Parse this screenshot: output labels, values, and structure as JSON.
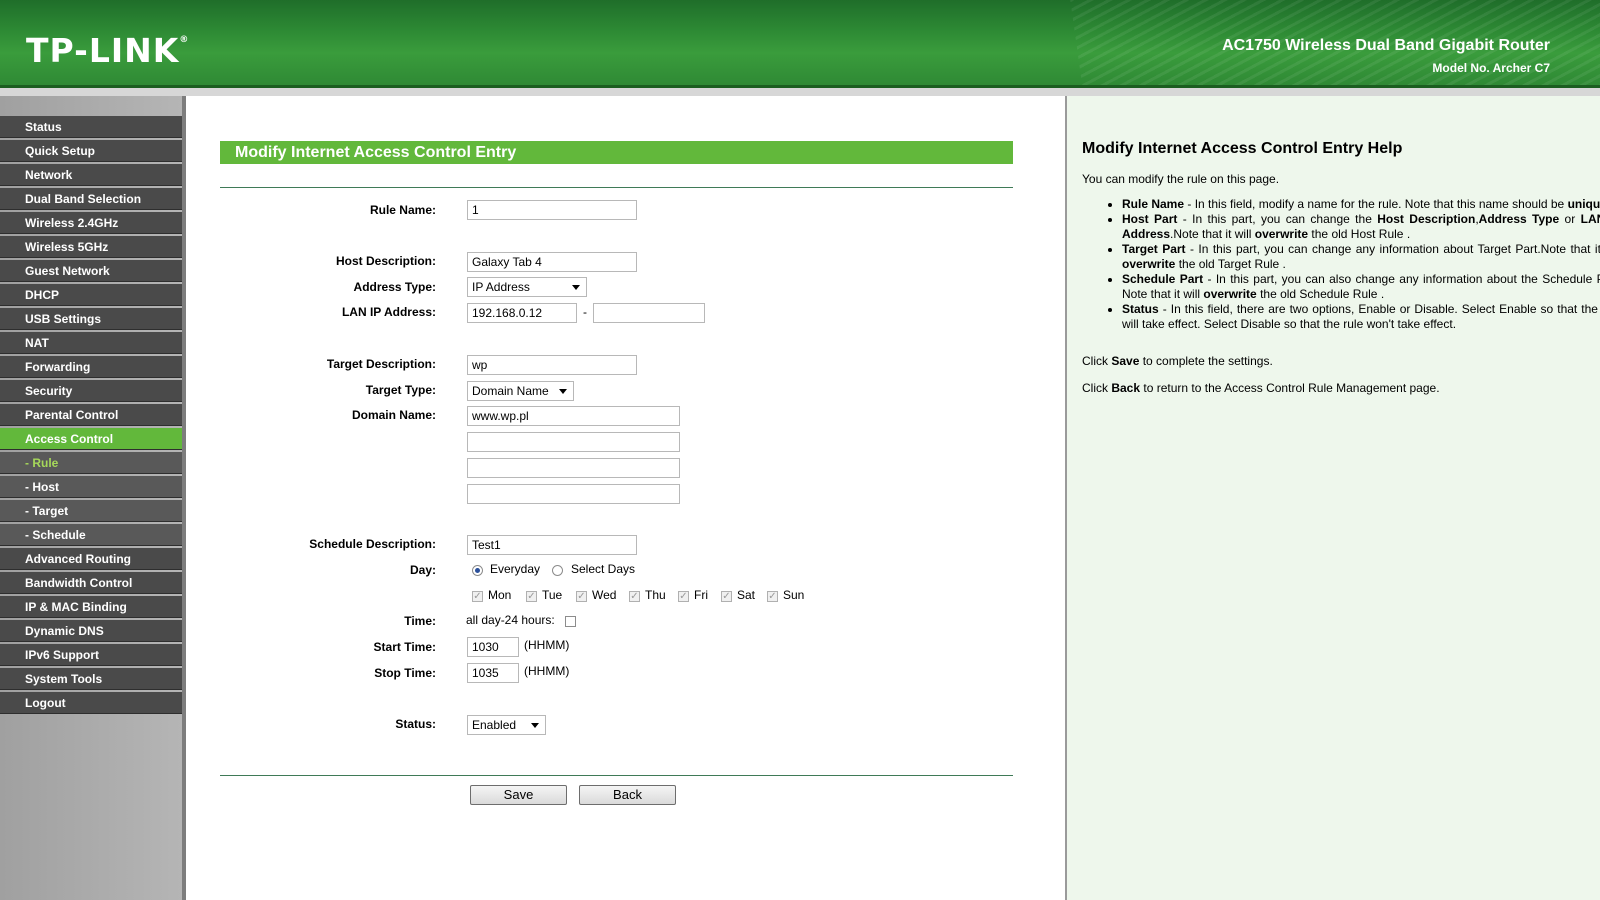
{
  "header": {
    "logo": "TP-LINK",
    "product_title": "AC1750 Wireless Dual Band Gigabit Router",
    "model": "Model No. Archer C7"
  },
  "sidebar": {
    "items": [
      {
        "label": "Status",
        "type": "main"
      },
      {
        "label": "Quick Setup",
        "type": "main"
      },
      {
        "label": "Network",
        "type": "main"
      },
      {
        "label": "Dual Band Selection",
        "type": "main"
      },
      {
        "label": "Wireless 2.4GHz",
        "type": "main"
      },
      {
        "label": "Wireless 5GHz",
        "type": "main"
      },
      {
        "label": "Guest Network",
        "type": "main"
      },
      {
        "label": "DHCP",
        "type": "main"
      },
      {
        "label": "USB Settings",
        "type": "main"
      },
      {
        "label": "NAT",
        "type": "main"
      },
      {
        "label": "Forwarding",
        "type": "main"
      },
      {
        "label": "Security",
        "type": "main"
      },
      {
        "label": "Parental Control",
        "type": "main"
      },
      {
        "label": "Access Control",
        "type": "active"
      },
      {
        "label": "- Rule",
        "type": "sub-active"
      },
      {
        "label": "- Host",
        "type": "sub"
      },
      {
        "label": "- Target",
        "type": "sub"
      },
      {
        "label": "- Schedule",
        "type": "sub"
      },
      {
        "label": "Advanced Routing",
        "type": "main"
      },
      {
        "label": "Bandwidth Control",
        "type": "main"
      },
      {
        "label": "IP & MAC Binding",
        "type": "main"
      },
      {
        "label": "Dynamic DNS",
        "type": "main"
      },
      {
        "label": "IPv6 Support",
        "type": "main"
      },
      {
        "label": "System Tools",
        "type": "main"
      },
      {
        "label": "Logout",
        "type": "main"
      }
    ]
  },
  "form": {
    "section_title": "Modify Internet Access Control Entry",
    "rule_name_label": "Rule Name:",
    "rule_name_value": "1",
    "host_description_label": "Host Description:",
    "host_description_value": "Galaxy Tab 4",
    "address_type_label": "Address Type:",
    "address_type_value": "IP Address",
    "lan_ip_label": "LAN IP Address:",
    "lan_ip_start": "192.168.0.12",
    "lan_ip_separator": "-",
    "lan_ip_end": "",
    "target_description_label": "Target Description:",
    "target_description_value": "wp",
    "target_type_label": "Target Type:",
    "target_type_value": "Domain Name",
    "domain_name_label": "Domain Name:",
    "domain_names": [
      "www.wp.pl",
      "",
      "",
      ""
    ],
    "schedule_description_label": "Schedule Description:",
    "schedule_description_value": "Test1",
    "day_label": "Day:",
    "day_everyday": "Everyday",
    "day_select_days": "Select Days",
    "days": [
      {
        "label": "Mon",
        "checked": true
      },
      {
        "label": "Tue",
        "checked": true
      },
      {
        "label": "Wed",
        "checked": true
      },
      {
        "label": "Thu",
        "checked": true
      },
      {
        "label": "Fri",
        "checked": true
      },
      {
        "label": "Sat",
        "checked": true
      },
      {
        "label": "Sun",
        "checked": true
      }
    ],
    "time_label": "Time:",
    "all_day_label": "all day-24 hours:",
    "start_time_label": "Start Time:",
    "start_time_value": "1030",
    "stop_time_label": "Stop Time:",
    "stop_time_value": "1035",
    "time_format": "(HHMM)",
    "status_label": "Status:",
    "status_value": "Enabled",
    "save_label": "Save",
    "back_label": "Back"
  },
  "help": {
    "title": "Modify Internet Access Control Entry Help",
    "intro": "You can modify the rule on this page.",
    "rule_name_term": "Rule Name",
    "rule_name_text_a": " - In this field, modify a name for the rule. Note that this name should be ",
    "rule_name_strong": "unique",
    "rule_name_text_b": ".",
    "host_term": "Host Part",
    "host_text_a": " - In this part, you can change the ",
    "host_strong_1": "Host Description",
    "host_comma": ",",
    "host_strong_2": "Address Type",
    "host_or": " or ",
    "host_strong_3": "LAN IP Address",
    "host_text_b": ".Note that it will ",
    "host_overwrite": "overwrite",
    "host_text_c": " the old Host Rule .",
    "target_term": "Target Part",
    "target_text_a": " - In this part, you can change any information about Target Part.Note that it will ",
    "target_overwrite": "overwrite",
    "target_text_b": " the old Target Rule .",
    "schedule_term": "Schedule Part",
    "schedule_text_a": " - In this part, you can also change any information about the Schedule Part. Note that it will ",
    "schedule_overwrite": "overwrite",
    "schedule_text_b": " the old Schedule Rule .",
    "status_term": "Status",
    "status_text": " - In this field, there are two options, Enable or Disable. Select Enable so that the rule will take effect. Select Disable so that the rule won't take effect.",
    "click_save_a": "Click ",
    "click_save_strong": "Save",
    "click_save_b": " to complete the settings.",
    "click_back_a": "Click ",
    "click_back_strong": "Back",
    "click_back_b": " to return to the Access Control Rule Management page."
  },
  "colors": {
    "header_green": "#2d8a34",
    "accent_green": "#62b83b",
    "menu_dark": "#4a4a4a",
    "help_bg": "#eef7ec"
  },
  "icons": {
    "select_arrow": "chevron-down-icon",
    "radio": "radio-icon",
    "checkbox": "checkbox-icon"
  }
}
